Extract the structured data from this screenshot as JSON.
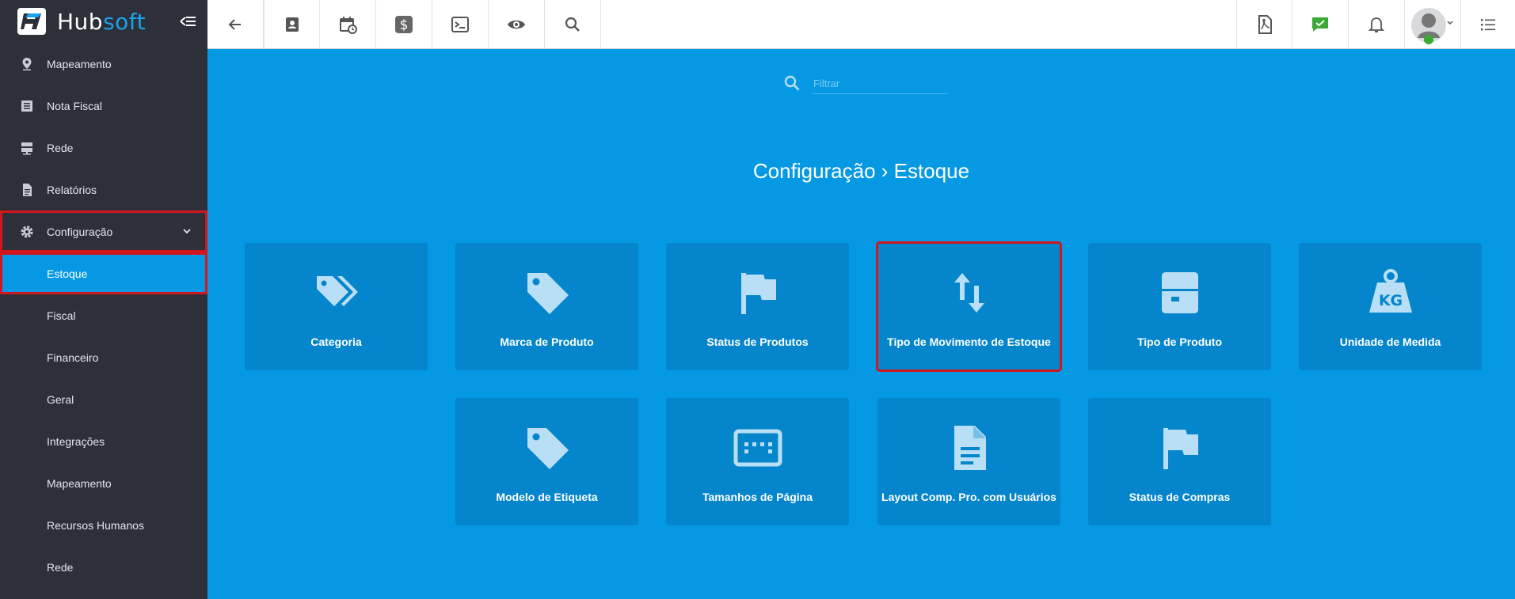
{
  "app": {
    "logo_hub": "Hub",
    "logo_soft": "soft"
  },
  "sidebar": {
    "items": [
      {
        "label": "Mapeamento",
        "icon": "map-pin-icon"
      },
      {
        "label": "Nota Fiscal",
        "icon": "document-list-icon"
      },
      {
        "label": "Rede",
        "icon": "network-icon"
      },
      {
        "label": "Relatórios",
        "icon": "report-icon"
      },
      {
        "label": "Configuração",
        "icon": "gear-icon"
      }
    ],
    "subitems": [
      {
        "label": "Estoque"
      },
      {
        "label": "Fiscal"
      },
      {
        "label": "Financeiro"
      },
      {
        "label": "Geral"
      },
      {
        "label": "Integrações"
      },
      {
        "label": "Mapeamento"
      },
      {
        "label": "Recursos Humanos"
      },
      {
        "label": "Rede"
      }
    ]
  },
  "toolbar": {
    "icons": [
      "back-arrow-icon",
      "contact-card-icon",
      "calendar-clock-icon",
      "dollar-icon",
      "terminal-icon",
      "eye-icon",
      "search-icon"
    ],
    "right_icons": [
      "pdf-icon",
      "chat-check-icon",
      "bell-icon",
      "avatar",
      "list-menu-icon"
    ]
  },
  "main": {
    "filter_placeholder": "Filtrar",
    "title": "Configuração › Estoque",
    "cards": [
      {
        "label": "Categoria",
        "icon": "tags-icon"
      },
      {
        "label": "Marca de Produto",
        "icon": "tag-icon"
      },
      {
        "label": "Status de Produtos",
        "icon": "flag-icon"
      },
      {
        "label": "Tipo de Movimento de Estoque",
        "icon": "swap-vertical-icon"
      },
      {
        "label": "Tipo de Produto",
        "icon": "box-icon"
      },
      {
        "label": "Unidade de Medida",
        "icon": "weight-kg-icon",
        "icon_text": "KG"
      },
      {
        "label": "Modelo de Etiqueta",
        "icon": "tag-icon"
      },
      {
        "label": "Tamanhos de Página",
        "icon": "page-size-icon"
      },
      {
        "label": "Layout Comp. Pro. com Usuários",
        "icon": "document-icon"
      },
      {
        "label": "Status de Compras",
        "icon": "flag-icon"
      }
    ]
  },
  "colors": {
    "sidebar_bg": "#2d3039",
    "main_bg": "#0599e4",
    "card_bg": "#0586cc",
    "highlight": "#d2161e",
    "icon_light": "#b8dff5"
  }
}
